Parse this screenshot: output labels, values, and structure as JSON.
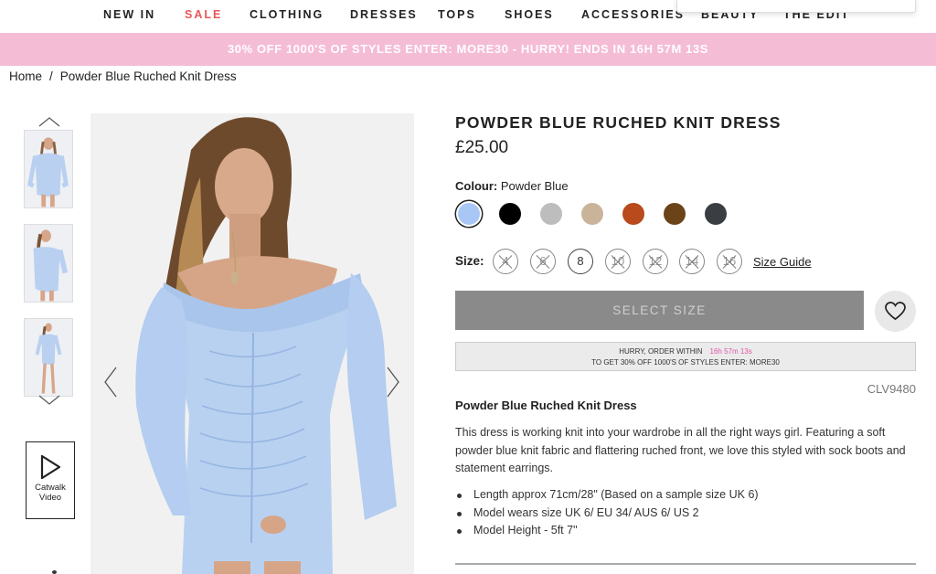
{
  "nav": {
    "items": [
      "NEW IN",
      "SALE",
      "CLOTHING",
      "DRESSES",
      "TOPS",
      "SHOES",
      "ACCESSORIES",
      "BEAUTY",
      "THE EDIT"
    ]
  },
  "promo": {
    "text": "30% OFF 1000'S OF STYLES ENTER: MORE30 - HURRY! ENDS IN 16H 57M 13S",
    "background": "#f5bcd6"
  },
  "breadcrumb": {
    "home": "Home",
    "separator": "/",
    "current": "Powder Blue Ruched Knit Dress"
  },
  "gallery": {
    "thumbnail_count": 3,
    "catwalk_label": "Catwalk Video"
  },
  "product": {
    "title": "POWDER BLUE RUCHED KNIT DRESS",
    "price": "£25.00",
    "colour_label": "Colour:",
    "colour_value": "Powder Blue",
    "colours": [
      "#a9c7f5",
      "#000000",
      "#bdbdbd",
      "#c9b49a",
      "#b84a1c",
      "#6b4318",
      "#3a3d42"
    ],
    "size_label": "Size:",
    "sizes": [
      {
        "label": "4",
        "available": false
      },
      {
        "label": "6",
        "available": false
      },
      {
        "label": "8",
        "available": true
      },
      {
        "label": "10",
        "available": false
      },
      {
        "label": "12",
        "available": false
      },
      {
        "label": "14",
        "available": false
      },
      {
        "label": "16",
        "available": false
      }
    ],
    "size_guide": "Size Guide",
    "select_size": "SELECT SIZE",
    "hurry_line1": "HURRY, ORDER WITHIN",
    "hurry_timer": "16h 57m 13s",
    "hurry_line2": "TO GET 30% OFF 1000'S OF STYLES ENTER: MORE30",
    "sku": "CLV9480",
    "desc_title": "Powder Blue Ruched Knit Dress",
    "description": "This dress is working knit into your wardrobe in all the right ways girl. Featuring a soft powder blue knit fabric and flattering ruched front, we love this styled with sock boots and statement earrings.",
    "bullets": [
      "Length approx 71cm/28\" (Based on a sample size UK 6)",
      "Model wears size UK 6/ EU 34/ AUS 6/ US 2",
      "Model Height - 5ft 7\""
    ]
  }
}
